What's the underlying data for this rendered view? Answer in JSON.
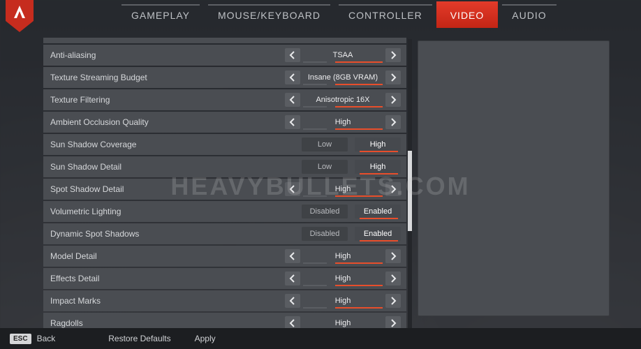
{
  "tabs": {
    "gameplay": "GAMEPLAY",
    "mousekb": "MOUSE/KEYBOARD",
    "controller": "CONTROLLER",
    "video": "VIDEO",
    "audio": "AUDIO"
  },
  "settings": [
    {
      "key": "anti_aliasing",
      "label": "Anti-aliasing",
      "type": "opt",
      "value": "TSAA"
    },
    {
      "key": "tex_stream_budget",
      "label": "Texture Streaming Budget",
      "type": "opt",
      "value": "Insane (8GB VRAM)"
    },
    {
      "key": "tex_filtering",
      "label": "Texture Filtering",
      "type": "opt",
      "value": "Anisotropic 16X"
    },
    {
      "key": "ao_quality",
      "label": "Ambient Occlusion Quality",
      "type": "opt",
      "value": "High"
    },
    {
      "key": "sun_shadow_cov",
      "label": "Sun Shadow Coverage",
      "type": "pair",
      "a": "Low",
      "b": "High",
      "selected": "b"
    },
    {
      "key": "sun_shadow_detail",
      "label": "Sun Shadow Detail",
      "type": "pair",
      "a": "Low",
      "b": "High",
      "selected": "b"
    },
    {
      "key": "spot_shadow_detail",
      "label": "Spot Shadow Detail",
      "type": "opt",
      "value": "High"
    },
    {
      "key": "volumetric_lighting",
      "label": "Volumetric Lighting",
      "type": "pair",
      "a": "Disabled",
      "b": "Enabled",
      "selected": "b"
    },
    {
      "key": "dyn_spot_shadows",
      "label": "Dynamic Spot Shadows",
      "type": "pair",
      "a": "Disabled",
      "b": "Enabled",
      "selected": "b"
    },
    {
      "key": "model_detail",
      "label": "Model Detail",
      "type": "opt",
      "value": "High"
    },
    {
      "key": "effects_detail",
      "label": "Effects Detail",
      "type": "opt",
      "value": "High"
    },
    {
      "key": "impact_marks",
      "label": "Impact Marks",
      "type": "opt",
      "value": "High"
    },
    {
      "key": "ragdolls",
      "label": "Ragdolls",
      "type": "opt",
      "value": "High"
    }
  ],
  "footer": {
    "esc_key": "ESC",
    "back": "Back",
    "restore": "Restore Defaults",
    "apply": "Apply"
  },
  "watermark": "HEAVYBULLETS.COM"
}
